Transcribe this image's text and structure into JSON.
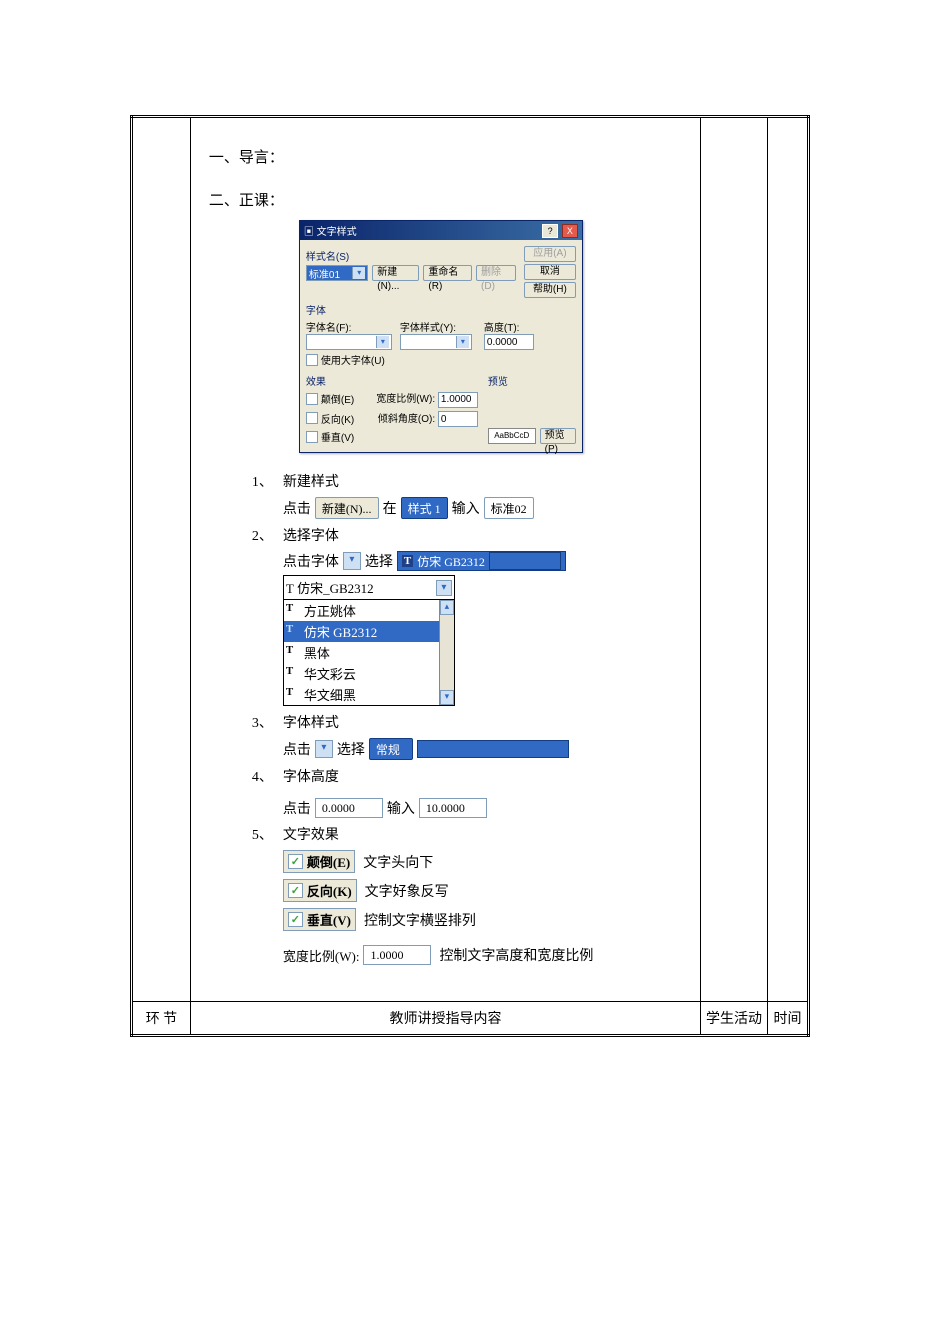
{
  "headings": {
    "intro": "一、导言：",
    "main": "二、正课："
  },
  "dialog": {
    "title": "文字样式",
    "help_icon": "?",
    "close_icon": "X",
    "grp_style": "样式名(S)",
    "style_value": "标准01",
    "btn_new": "新建(N)...",
    "btn_rename": "重命名(R)",
    "btn_delete": "删除(D)",
    "btn_apply": "应用(A)",
    "btn_cancel": "取消",
    "btn_help": "帮助(H)",
    "grp_font": "字体",
    "lbl_fontname": "字体名(F):",
    "lbl_fontstyle": "字体样式(Y):",
    "lbl_height": "高度(T):",
    "height_value": "0.0000",
    "ck_bigfont": "使用大字体(U)",
    "grp_effect": "效果",
    "ck_upside": "颠倒(E)",
    "ck_reverse": "反向(K)",
    "ck_vertical": "垂直(V)",
    "lbl_widthratio": "宽度比例(W):",
    "widthratio_value": "1.0000",
    "lbl_angle": "倾斜角度(O):",
    "angle_value": "0",
    "grp_preview": "预览",
    "preview_text": "AaBbCcD",
    "btn_preview": "预览(P)"
  },
  "steps": {
    "s1_num": "1、",
    "s1_title": "新建样式",
    "s1_click": "点击",
    "s1_new_btn": "新建(N)...",
    "s1_at": "在",
    "s1_style1": "样式 1",
    "s1_input": "输入",
    "s1_std02": "标准02",
    "s2_num": "2、",
    "s2_title": "选择字体",
    "s2_line": "点击字体",
    "s2_select": "选择",
    "s2_font_sel": "仿宋 GB2312",
    "fontlist_top": "仿宋_GB2312",
    "fontlist_items": [
      "方正姚体",
      "仿宋 GB2312",
      "黑体",
      "华文彩云",
      "华文细黑"
    ],
    "s3_num": "3、",
    "s3_title": "字体样式",
    "s3_click": "点击",
    "s3_select": "选择",
    "s3_value": "常规",
    "s4_num": "4、",
    "s4_title": "字体高度",
    "s4_click": "点击",
    "s4_val1": "0.0000",
    "s4_input": "输入",
    "s4_val2": "10.0000",
    "s5_num": "5、",
    "s5_title": "文字效果",
    "s5_ck1": "颠倒(E)",
    "s5_ck1_note": "文字头向下",
    "s5_ck2": "反向(K)",
    "s5_ck2_note": "文字好象反写",
    "s5_ck3": "垂直(V)",
    "s5_ck3_note": "控制文字横竖排列",
    "s5_width_lbl": "宽度比例(W):",
    "s5_width_val": "1.0000",
    "s5_width_note": "控制文字高度和宽度比例"
  },
  "footer": {
    "col1": "环 节",
    "col2": "教师讲授指导内容",
    "col3": "学生活动",
    "col4": "时间"
  }
}
